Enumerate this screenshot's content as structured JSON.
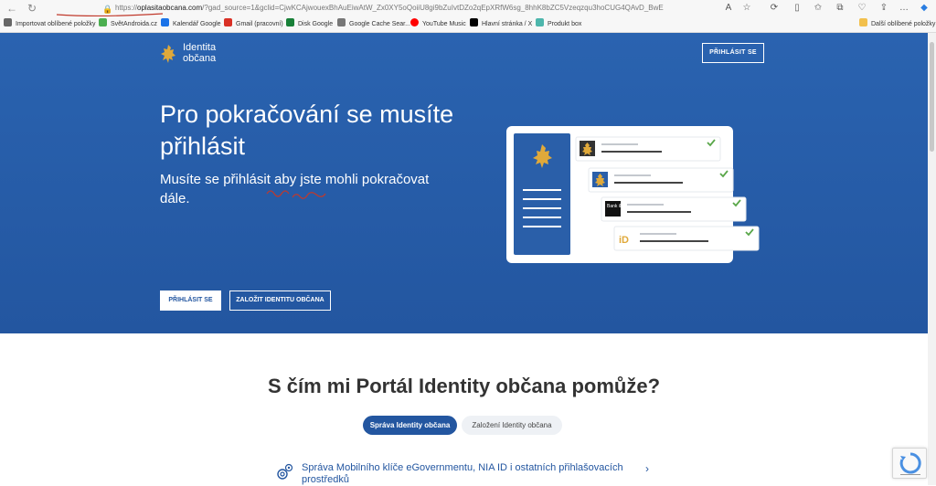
{
  "browser": {
    "url_prefix": "https://",
    "url_domain": "oplasitaobcana.com",
    "url_rest": "/?gad_source=1&gclid=CjwKCAjwouexBhAuEiwAtW_Zx0XY5oQoiiU8gi9bZuIvtDZo2qEpXRfW6sg_8hhK8bZC5Vzeqzqu3hoCUG4QAvD_BwE",
    "bookmarks": [
      {
        "label": "Importovat oblíbené položky",
        "color": "#666666"
      },
      {
        "label": "SvětAndroida.cz",
        "color": "#4caf50"
      },
      {
        "label": "Kalendář Google",
        "color": "#1a73e8"
      },
      {
        "label": "Gmail (pracovní)",
        "color": "#d93025"
      },
      {
        "label": "Disk Google",
        "color": "#188038"
      },
      {
        "label": "Google Cache Sear...",
        "color": "#777777"
      },
      {
        "label": "YouTube Music",
        "color": "#ff0000"
      },
      {
        "label": "Hlavní stránka / X",
        "color": "#000000"
      },
      {
        "label": "Produkt box",
        "color": "#4db6ac"
      }
    ],
    "other_favorites": "Další oblíbené položky"
  },
  "header": {
    "logo_line1": "Identita",
    "logo_line2": "občana",
    "login_label": "PŘIHLÁSIT SE"
  },
  "hero": {
    "title": "Pro pokračování se musíte přihlásit",
    "subtitle": "Musíte se přihlásit aby jste mohli pokračovat dále.",
    "primary_button": "PŘIHLÁSIT SE",
    "secondary_button": "ZALOŽIT IDENTITU OBČANA"
  },
  "illustration": {
    "card3_label": "Bank iD",
    "card4_label": "iD"
  },
  "section": {
    "title": "S čím mi Portál Identity občana pomůže?",
    "tab_active": "Správa Identity občana",
    "tab_inactive": "Založení Identity občana",
    "service_item": "Správa Mobilního klíče eGovernmentu, NIA ID i ostatních přihlašovacích prostředků"
  },
  "colors": {
    "hero_blue": "#2356a0",
    "accent_gold": "#e0a93a",
    "check_green": "#5aa74a"
  }
}
